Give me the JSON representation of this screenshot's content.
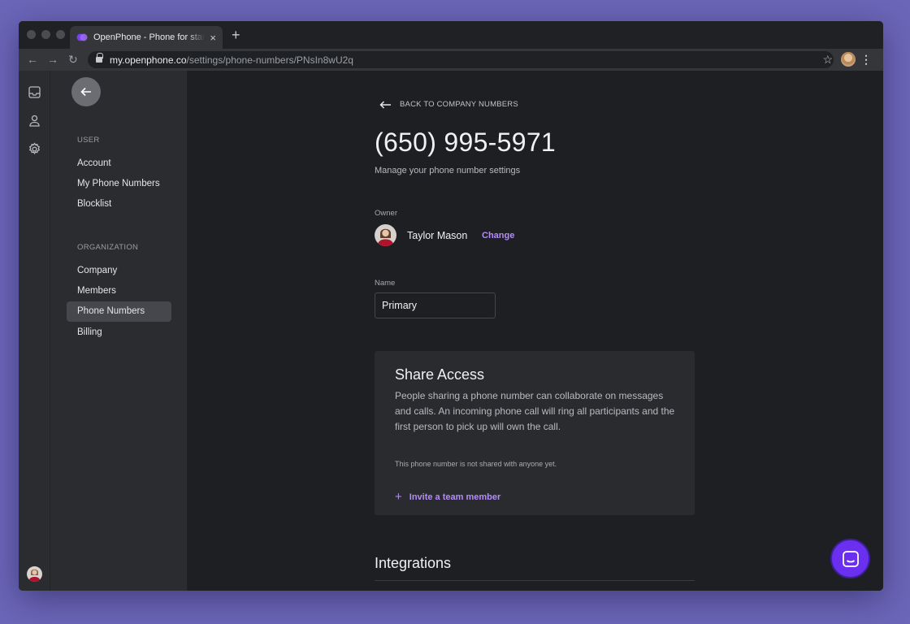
{
  "browser": {
    "tab_title": "OpenPhone - Phone for startups",
    "url_host": "my.openphone.co",
    "url_path": "/settings/phone-numbers/PNsIn8wU2q",
    "accent": "#7b3ff2"
  },
  "settings_nav": {
    "user_section": "USER",
    "user_items": [
      "Account",
      "My Phone Numbers",
      "Blocklist"
    ],
    "org_section": "ORGANIZATION",
    "org_items": [
      "Company",
      "Members",
      "Phone Numbers",
      "Billing"
    ],
    "active_item": "Phone Numbers"
  },
  "rail": {
    "icons": [
      "inbox-icon",
      "person-icon",
      "gear-icon"
    ]
  },
  "page": {
    "back_label": "BACK TO COMPANY NUMBERS",
    "title": "(650) 995-5971",
    "subtitle": "Manage your phone number settings",
    "owner": {
      "label": "Owner",
      "name": "Taylor Mason",
      "change_label": "Change"
    },
    "name_field": {
      "label": "Name",
      "value": "Primary"
    },
    "share": {
      "title": "Share Access",
      "description": "People sharing a phone number can collaborate on messages and calls. An incoming phone call will ring all participants and the first person to pick up will own the call.",
      "empty_text": "This phone number is not shared with anyone yet.",
      "invite_label": "Invite a team member"
    },
    "integrations_title": "Integrations"
  },
  "colors": {
    "link": "#b48cf6",
    "chat_bubble": "#6b2ff0",
    "active_nav": "#46474c"
  }
}
